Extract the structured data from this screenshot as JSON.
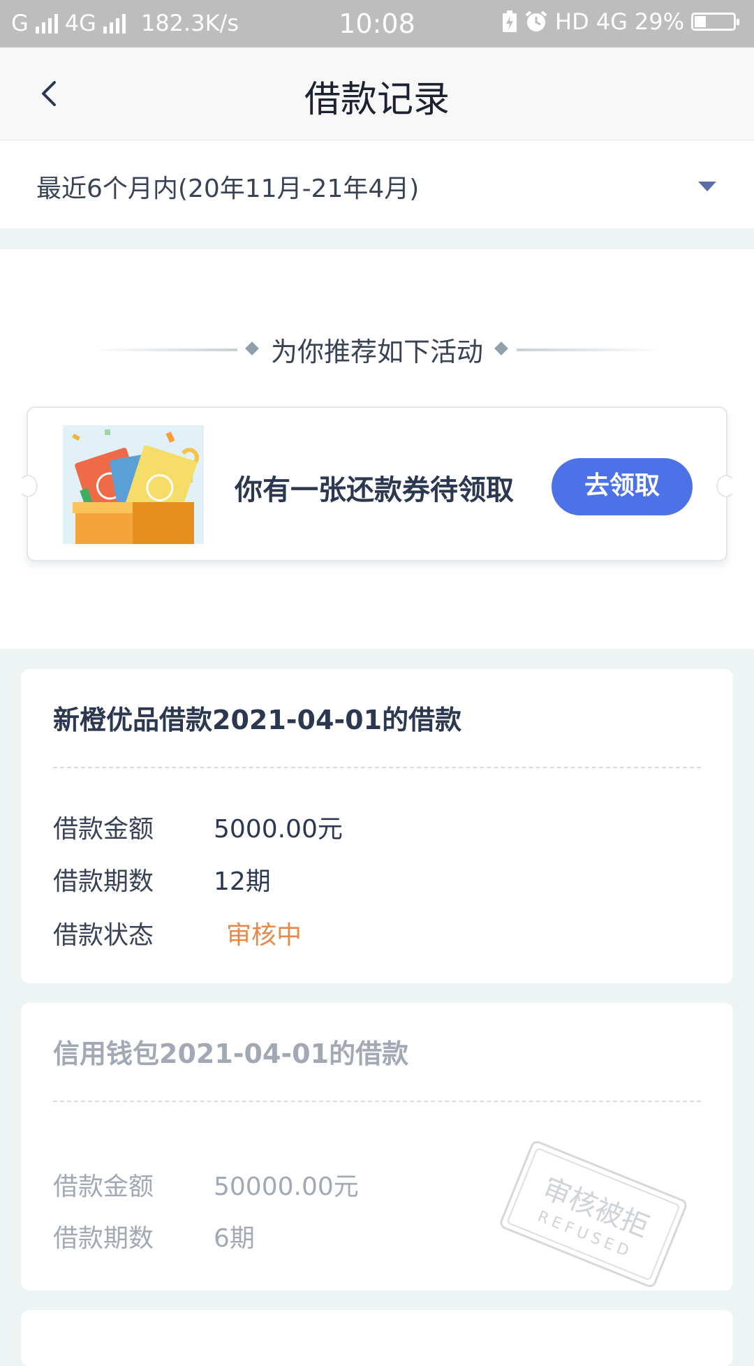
{
  "status_bar": {
    "carrier1": "G",
    "carrier2": "4G",
    "speed": "182.3K/s",
    "time": "10:08",
    "hd": "HD",
    "network": "4G",
    "battery_percent": "29%",
    "battery_level": 0.29,
    "icons": [
      "signal-icon",
      "charging-icon",
      "alarm-icon",
      "battery-icon"
    ]
  },
  "header": {
    "title": "借款记录",
    "back_icon": "chevron-left-icon"
  },
  "filter": {
    "label": "最近6个月内(20年11月-21年4月)"
  },
  "recommend": {
    "heading": "为你推荐如下活动",
    "coupon_text": "你有一张还款券待领取",
    "claim_button": "去领取"
  },
  "loans": [
    {
      "title": "新橙优品借款2021-04-01的借款",
      "amount_label": "借款金额",
      "amount": "5000.00元",
      "term_label": "借款期数",
      "term": "12期",
      "status_label": "借款状态",
      "status": "审核中",
      "status_color": "#e8894a"
    },
    {
      "title": "信用钱包2021-04-01的借款",
      "amount_label": "借款金额",
      "amount": "50000.00元",
      "term_label": "借款期数",
      "term": "6期",
      "stamp_text": "审核被拒",
      "stamp_subtext": "REFUSED"
    }
  ],
  "colors": {
    "accent": "#4d72e8",
    "pending": "#e8894a",
    "background": "#eef3f4"
  }
}
